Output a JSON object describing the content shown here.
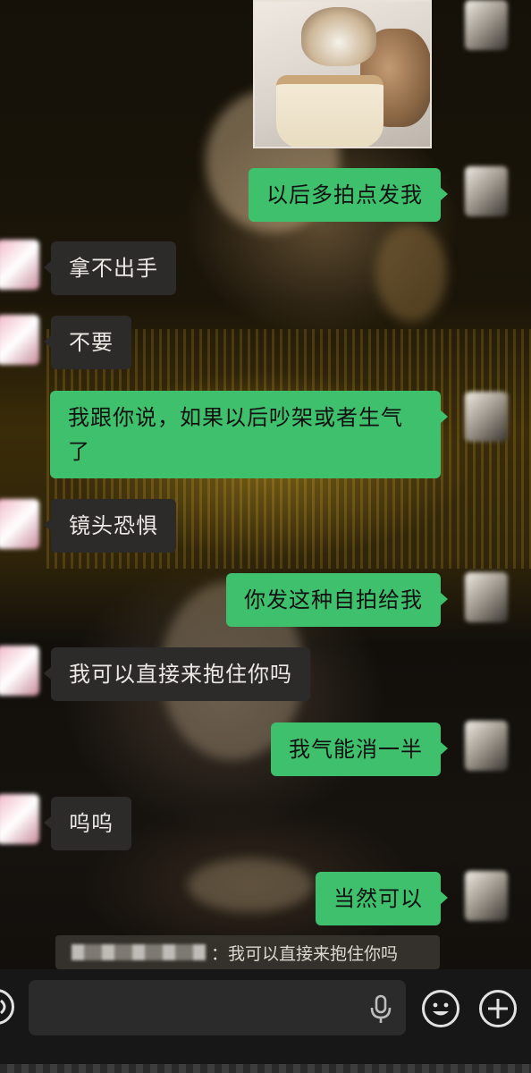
{
  "messages": [
    {
      "side": "right",
      "text": "以后多拍点发我"
    },
    {
      "side": "left",
      "text": "拿不出手"
    },
    {
      "side": "left",
      "text": "不要"
    },
    {
      "side": "right",
      "text": "我跟你说，如果以后吵架或者生气了"
    },
    {
      "side": "left",
      "text": "镜头恐惧"
    },
    {
      "side": "right",
      "text": "你发这种自拍给我"
    },
    {
      "side": "left",
      "text": "我可以直接来抱住你吗"
    },
    {
      "side": "right",
      "text": "我气能消一半"
    },
    {
      "side": "left",
      "text": "呜呜"
    },
    {
      "side": "right",
      "text": "当然可以"
    }
  ],
  "quote": {
    "text": "：我可以直接来抱住你吗"
  },
  "input_bar": {
    "input_value": "",
    "icons": [
      "voice-icon",
      "microphone-icon",
      "emoji-icon",
      "plus-icon"
    ]
  },
  "colors": {
    "my_bubble": "#3fc06c",
    "their_bubble": "#2c2b2a",
    "input_bar": "#171717"
  }
}
